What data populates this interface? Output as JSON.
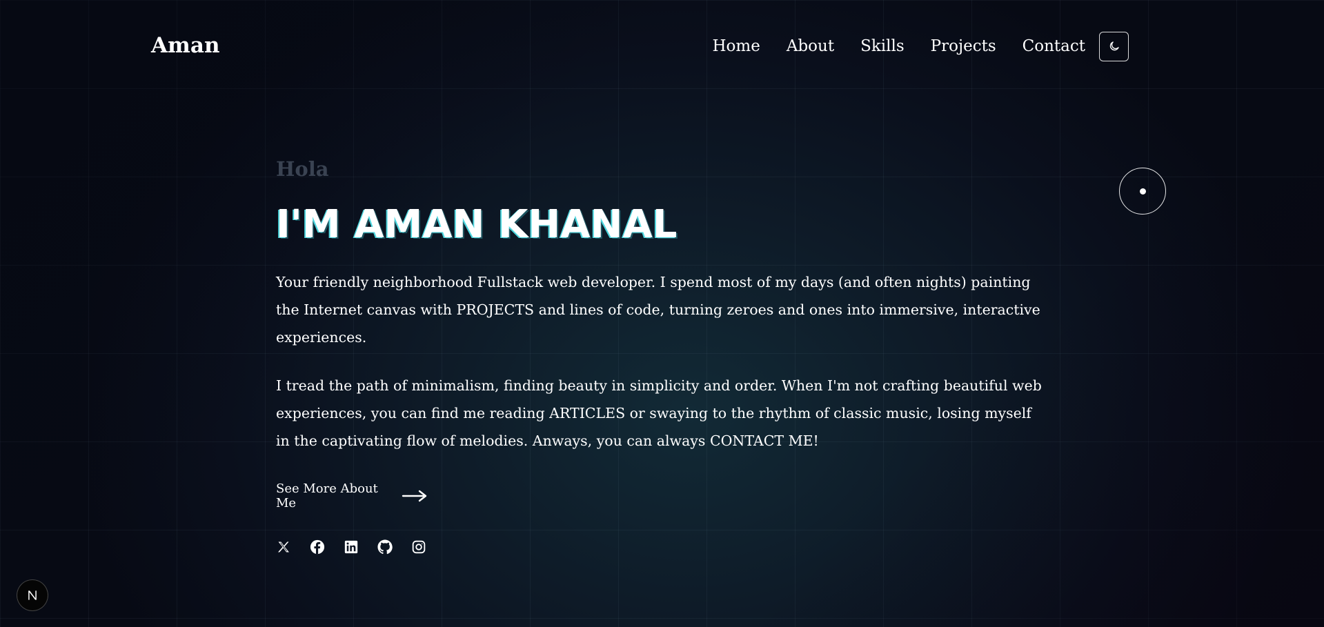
{
  "header": {
    "brand": "Aman",
    "nav": [
      {
        "label": "Home"
      },
      {
        "label": "About"
      },
      {
        "label": "Skills"
      },
      {
        "label": "Projects"
      },
      {
        "label": "Contact"
      }
    ],
    "theme_toggle_icon": "moon-icon"
  },
  "hero": {
    "greeting": "Hola",
    "headline": "I'M AMAN KHANAL",
    "para1": {
      "before": "Your friendly neighborhood Fullstack web developer. I spend most of my days (and often nights) painting the Internet canvas with ",
      "link": "PROJECTS",
      "after": " and lines of code, turning zeroes and ones into immersive, interactive experiences."
    },
    "para2": {
      "part1": "I tread the path of minimalism, finding beauty in simplicity and order. When I'm not crafting beautiful web experiences, you can find me reading ",
      "link1": "ARTICLES",
      "part2": " or swaying to the rhythm of classic music, losing myself in the captivating flow of melodies. Anways, you can always ",
      "link2": "CONTACT ME!"
    },
    "see_more": "See More About Me",
    "socials": [
      "x-icon",
      "facebook-icon",
      "linkedin-icon",
      "github-icon",
      "instagram-icon"
    ]
  },
  "colors": {
    "background": "#0a0f1c",
    "text": "#ffffff",
    "greeting": "#3a4352",
    "headline_accent": "#4dd6de"
  },
  "badge": {
    "letter": "N",
    "icon": "nextjs-icon"
  }
}
